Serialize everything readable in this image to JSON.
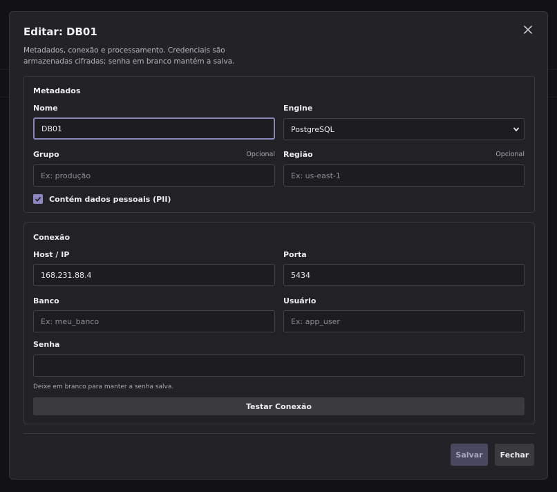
{
  "modal": {
    "title": "Editar: DB01",
    "description": "Metadados, conexão e processamento. Credenciais são armazenadas cifradas; senha em branco mantém a salva."
  },
  "metadata": {
    "section_title": "Metadados",
    "name": {
      "label": "Nome",
      "value": "DB01"
    },
    "engine": {
      "label": "Engine",
      "value": "PostgreSQL"
    },
    "group": {
      "label": "Grupo",
      "optional": "Opcional",
      "placeholder": "Ex: produção"
    },
    "region": {
      "label": "Região",
      "optional": "Opcional",
      "placeholder": "Ex: us-east-1"
    },
    "pii": {
      "label": "Contém dados pessoais (PII)",
      "checked": true
    }
  },
  "connection": {
    "section_title": "Conexão",
    "host": {
      "label": "Host / IP",
      "value": "168.231.88.4"
    },
    "port": {
      "label": "Porta",
      "value": "5434"
    },
    "database": {
      "label": "Banco",
      "placeholder": "Ex: meu_banco"
    },
    "user": {
      "label": "Usuário",
      "placeholder": "Ex: app_user"
    },
    "password": {
      "label": "Senha",
      "value": "",
      "hint": "Deixe em branco para manter a senha salva."
    },
    "test_button": "Testar Conexão"
  },
  "footer": {
    "save": "Salvar",
    "close": "Fechar"
  },
  "colors": {
    "accent": "#8b86c0",
    "save_button": "#484860",
    "focus_border": "#8888b8"
  }
}
